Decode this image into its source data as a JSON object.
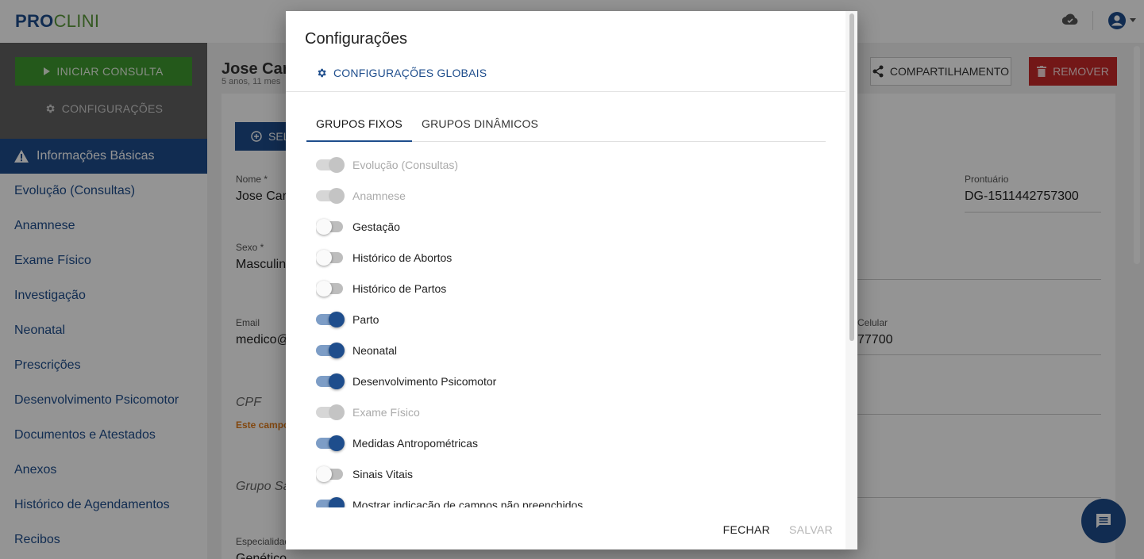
{
  "app": {
    "logo_part1": "PRO",
    "logo_part2": "CLINI"
  },
  "sidebar": {
    "start_button": "INICIAR CONSULTA",
    "config_button": "CONFIGURAÇÕES",
    "items": [
      {
        "label": "Informações Básicas",
        "active": true
      },
      {
        "label": "Evolução (Consultas)"
      },
      {
        "label": "Anamnese"
      },
      {
        "label": "Exame Físico"
      },
      {
        "label": "Investigação"
      },
      {
        "label": "Neonatal"
      },
      {
        "label": "Prescrições"
      },
      {
        "label": "Desenvolvimento Psicomotor"
      },
      {
        "label": "Documentos e Atestados"
      },
      {
        "label": "Anexos"
      },
      {
        "label": "Histórico de Agendamentos"
      },
      {
        "label": "Recibos"
      }
    ]
  },
  "patient": {
    "name": "Jose Carl",
    "age": "5 anos, 11 mes",
    "share_button": "COMPARTILHAMENTO",
    "remove_button": "REMOVER",
    "select_button": "SEL",
    "fields": {
      "nome_label": "Nome *",
      "nome_value": "Jose Car",
      "prontuario_label": "Prontuário",
      "prontuario_value": "DG-1511442757300",
      "sexo_label": "Sexo *",
      "sexo_value": "Masculin",
      "email_label": "Email",
      "email_value": "medico@",
      "celular_label": "Celular",
      "celular_value": "77700",
      "cpf_placeholder": "CPF",
      "cpf_error": "Este campo",
      "grupo_placeholder": "Grupo Sa",
      "especialidade_label": "Especialidad",
      "especialidade_value": "Genético"
    }
  },
  "dialog": {
    "title": "Configurações",
    "global_button": "CONFIGURAÇÕES GLOBAIS",
    "tabs": [
      {
        "label": "GRUPOS FIXOS",
        "active": true
      },
      {
        "label": "GRUPOS DINÂMICOS",
        "active": false
      }
    ],
    "toggles": [
      {
        "label": "Evolução (Consultas)",
        "state": "disabled-on"
      },
      {
        "label": "Anamnese",
        "state": "disabled-on"
      },
      {
        "label": "Gestação",
        "state": "off"
      },
      {
        "label": "Histórico de Abortos",
        "state": "off"
      },
      {
        "label": "Histórico de Partos",
        "state": "off"
      },
      {
        "label": "Parto",
        "state": "on"
      },
      {
        "label": "Neonatal",
        "state": "on"
      },
      {
        "label": "Desenvolvimento Psicomotor",
        "state": "on"
      },
      {
        "label": "Exame Físico",
        "state": "disabled-on"
      },
      {
        "label": "Medidas Antropométricas",
        "state": "on"
      },
      {
        "label": "Sinais Vitais",
        "state": "off"
      },
      {
        "label": "Mostrar indicação de campos não preenchidos",
        "state": "on"
      }
    ],
    "close_button": "FECHAR",
    "save_button": "SALVAR"
  },
  "colors": {
    "primary": "#1e4d8c",
    "success": "#3f9a2f",
    "danger": "#c62828"
  }
}
